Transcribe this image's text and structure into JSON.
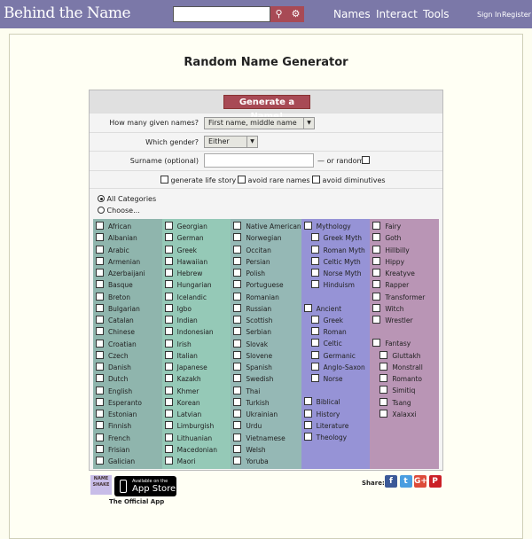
{
  "header": {
    "logo": "Behind the Name",
    "search_placeholder": "",
    "nav": [
      "Names",
      "Interact",
      "Tools"
    ],
    "sign_in": "Sign In",
    "register": "Register",
    "brand_color": "#7b78a8",
    "accent_color": "#a84a55"
  },
  "page": {
    "title": "Random Name Generator"
  },
  "form": {
    "generate_label": "Generate a Name!",
    "given_names_label": "How many given names?",
    "given_names_value": "First name, middle name",
    "gender_label": "Which gender?",
    "gender_value": "Either",
    "surname_label": "Surname (optional)",
    "surname_value": "",
    "or_random_label": "— or random",
    "options": [
      "generate life story",
      "avoid rare names",
      "avoid diminutives"
    ],
    "all_categories": "All Categories",
    "choose": "Choose..."
  },
  "columns": [
    {
      "color": "#8fb5ad",
      "groups": [
        {
          "items": [
            "African",
            "Albanian",
            "Arabic",
            "Armenian",
            "Azerbaijani",
            "Basque",
            "Breton",
            "Bulgarian",
            "Catalan",
            "Chinese",
            "Croatian",
            "Czech",
            "Danish",
            "Dutch",
            "English",
            "Esperanto",
            "Estonian",
            "Finnish",
            "French",
            "Frisian",
            "Galician"
          ]
        }
      ]
    },
    {
      "color": "#95c9b7",
      "groups": [
        {
          "items": [
            "Georgian",
            "German",
            "Greek",
            "Hawaiian",
            "Hebrew",
            "Hungarian",
            "Icelandic",
            "Igbo",
            "Indian",
            "Indonesian",
            "Irish",
            "Italian",
            "Japanese",
            "Kazakh",
            "Khmer",
            "Korean",
            "Latvian",
            "Limburgish",
            "Lithuanian",
            "Macedonian",
            "Maori"
          ]
        }
      ]
    },
    {
      "color": "#95b8b5",
      "groups": [
        {
          "items": [
            "Native American",
            "Norwegian",
            "Occitan",
            "Persian",
            "Polish",
            "Portuguese",
            "Romanian",
            "Russian",
            "Scottish",
            "Serbian",
            "Slovak",
            "Slovene",
            "Spanish",
            "Swedish",
            "Thai",
            "Turkish",
            "Ukrainian",
            "Urdu",
            "Vietnamese",
            "Welsh",
            "Yoruba"
          ]
        }
      ]
    },
    {
      "color": "#9693d6",
      "groups": [
        {
          "head": "Mythology",
          "items": [
            "Greek Myth",
            "Roman Myth",
            "Celtic Myth",
            "Norse Myth",
            "Hinduism"
          ]
        },
        {
          "head": "Ancient",
          "items": [
            "Greek",
            "Roman",
            "Celtic",
            "Germanic",
            "Anglo-Saxon",
            "Norse"
          ]
        },
        {
          "items": [
            "Biblical",
            "History",
            "Literature",
            "Theology"
          ]
        }
      ]
    },
    {
      "color": "#b995b5",
      "groups": [
        {
          "items": [
            "Fairy",
            "Goth",
            "Hillbilly",
            "Hippy",
            "Kreatyve",
            "Rapper",
            "Transformer",
            "Witch",
            "Wrestler"
          ]
        },
        {
          "head": "Fantasy",
          "items": [
            "Gluttakh",
            "Monstrall",
            "Romanto",
            "Simitiq",
            "Tsang",
            "Xalaxxi"
          ]
        }
      ]
    }
  ],
  "footer": {
    "nameshake": "NAME SHAKE",
    "app_store_small": "Available on the",
    "app_store_big": "App Store",
    "official_app": "The Official App",
    "share_label": "Share:",
    "social": [
      {
        "name": "facebook",
        "glyph": "f",
        "color": "#3b5998"
      },
      {
        "name": "twitter",
        "glyph": "t",
        "color": "#4a9ee0"
      },
      {
        "name": "google-plus",
        "glyph": "G+",
        "color": "#dd4b39"
      },
      {
        "name": "pinterest",
        "glyph": "P",
        "color": "#cb2027"
      }
    ]
  }
}
